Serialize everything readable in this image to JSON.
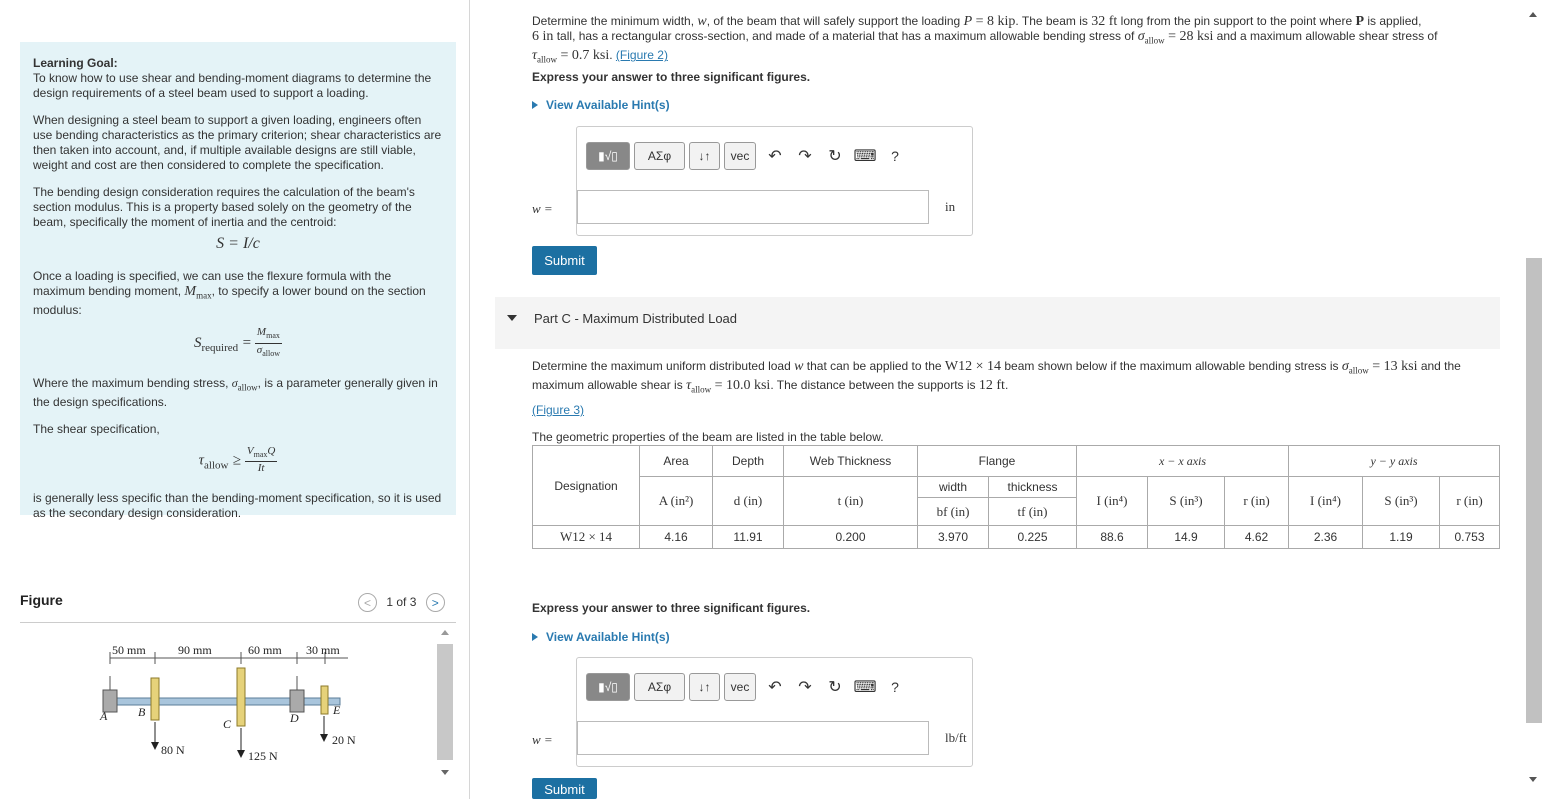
{
  "learning_goal": {
    "heading": "Learning Goal:",
    "intro": "To know how to use shear and bending-moment diagrams to determine the design requirements of a steel beam used to support a loading.",
    "p1": "When designing a steel beam to support a given loading, engineers often use bending characteristics as the primary criterion; shear characteristics are then taken into account, and, if multiple available designs are still viable, weight and cost are then considered to complete the specification.",
    "p2": "The bending design consideration requires the calculation of the beam's section modulus. This is a property based solely on the geometry of the beam, specifically the moment of inertia and the centroid:",
    "eq1": "S = I/c",
    "p3a": "Once a loading is specified, we can use the flexure formula with the maximum bending moment, ",
    "p3m": "M",
    "p3s": "max",
    "p3b": ", to specify a lower bound on the section modulus:",
    "eq2_lhs": "S",
    "eq2_lhs_sub": "required",
    "eq2_num": "M",
    "eq2_num_sub": "max",
    "eq2_den": "σ",
    "eq2_den_sub": "allow",
    "p4a": "Where the maximum bending stress, ",
    "p4m": "σ",
    "p4s": "allow",
    "p4b": ", is a parameter generally given in the design specifications.",
    "p5": "The shear specification,",
    "eq3_lhs": "τ",
    "eq3_lhs_sub": "allow",
    "eq3_num": "V",
    "eq3_num_sub": "max",
    "eq3_num2": "Q",
    "eq3_den": "It",
    "p6": "is generally less specific than the bending-moment specification, so it is used as the secondary design consideration."
  },
  "figure": {
    "title": "Figure",
    "pager": "1 of 3",
    "dims": [
      "50 mm",
      "90 mm",
      "60 mm",
      "30 mm"
    ],
    "points": [
      "A",
      "B",
      "C",
      "D",
      "E"
    ],
    "loads": [
      "80 N",
      "125 N",
      "20 N"
    ]
  },
  "partB": {
    "text1": "Determine the minimum width, ",
    "w": "w",
    "text2": ", of the beam that will safely support the loading ",
    "P": "P",
    "Pval": " = 8 kip",
    "text3": ". The beam is ",
    "len": "32 ft",
    "text4": " long from the pin support to the point where ",
    "P2": "P",
    "text5": " is applied,",
    "tall": "6 in",
    "text6": " tall, has a rectangular cross-section, and made of a material that has a maximum allowable bending stress of ",
    "sig": "σ",
    "sig_sub": "allow",
    "sig_val": " = 28 ksi",
    "text7": " and a maximum allowable shear stress of",
    "tau": "τ",
    "tau_sub": "allow",
    "tau_val": " = 0.7 ksi",
    "text8": ". ",
    "fig_link": "(Figure 2)",
    "instruction": "Express your answer to three significant figures.",
    "hint": "View Available Hint(s)",
    "answer_label": "w =",
    "answer_value": "",
    "answer_unit": "in",
    "submit": "Submit"
  },
  "toolbar": {
    "greek": "ΑΣφ",
    "arrows": "↓↑",
    "vec": "vec",
    "undo": "↶",
    "redo": "↷",
    "reset": "↻",
    "keyboard": "⌨",
    "help": "?"
  },
  "partC": {
    "title": "Part C - Maximum Distributed Load",
    "text1": "Determine the maximum uniform distributed load ",
    "w": "w",
    "text2": " that can be applied to the ",
    "beam": "W12 × 14",
    "text3": " beam shown below if the maximum allowable bending stress is ",
    "sig": "σ",
    "sig_sub": "allow",
    "sig_val": " = 13 ksi",
    "text4": " and the",
    "text5": "maximum allowable shear is ",
    "tau": "τ",
    "tau_sub": "allow",
    "tau_val": " = 10.0 ksi",
    "text6": ". The distance between the supports is ",
    "dist": "12 ft",
    "text7": ".",
    "fig_link": "(Figure 3)",
    "table_intro": "The geometric properties of the beam are listed in the table below.",
    "instruction": "Express your answer to three significant figures.",
    "hint": "View Available Hint(s)",
    "answer_label": "w =",
    "answer_value": "",
    "answer_unit": "lb/ft",
    "submit": "Submit"
  },
  "table": {
    "designation": "Designation",
    "area": "Area",
    "depth": "Depth",
    "web": "Web Thickness",
    "flange": "Flange",
    "xaxis": "x − x axis",
    "yaxis": "y − y axis",
    "width": "width",
    "thickness": "thickness",
    "u_area": "A (in²)",
    "u_depth": "d (in)",
    "u_web": "t (in)",
    "u_bf": "bf (in)",
    "u_tf": "tf (in)",
    "u_I": "I (in⁴)",
    "u_S": "S (in³)",
    "u_r": "r (in)",
    "row": [
      "W12 × 14",
      "4.16",
      "11.91",
      "0.200",
      "3.970",
      "0.225",
      "88.6",
      "14.9",
      "4.62",
      "2.36",
      "1.19",
      "0.753"
    ]
  }
}
